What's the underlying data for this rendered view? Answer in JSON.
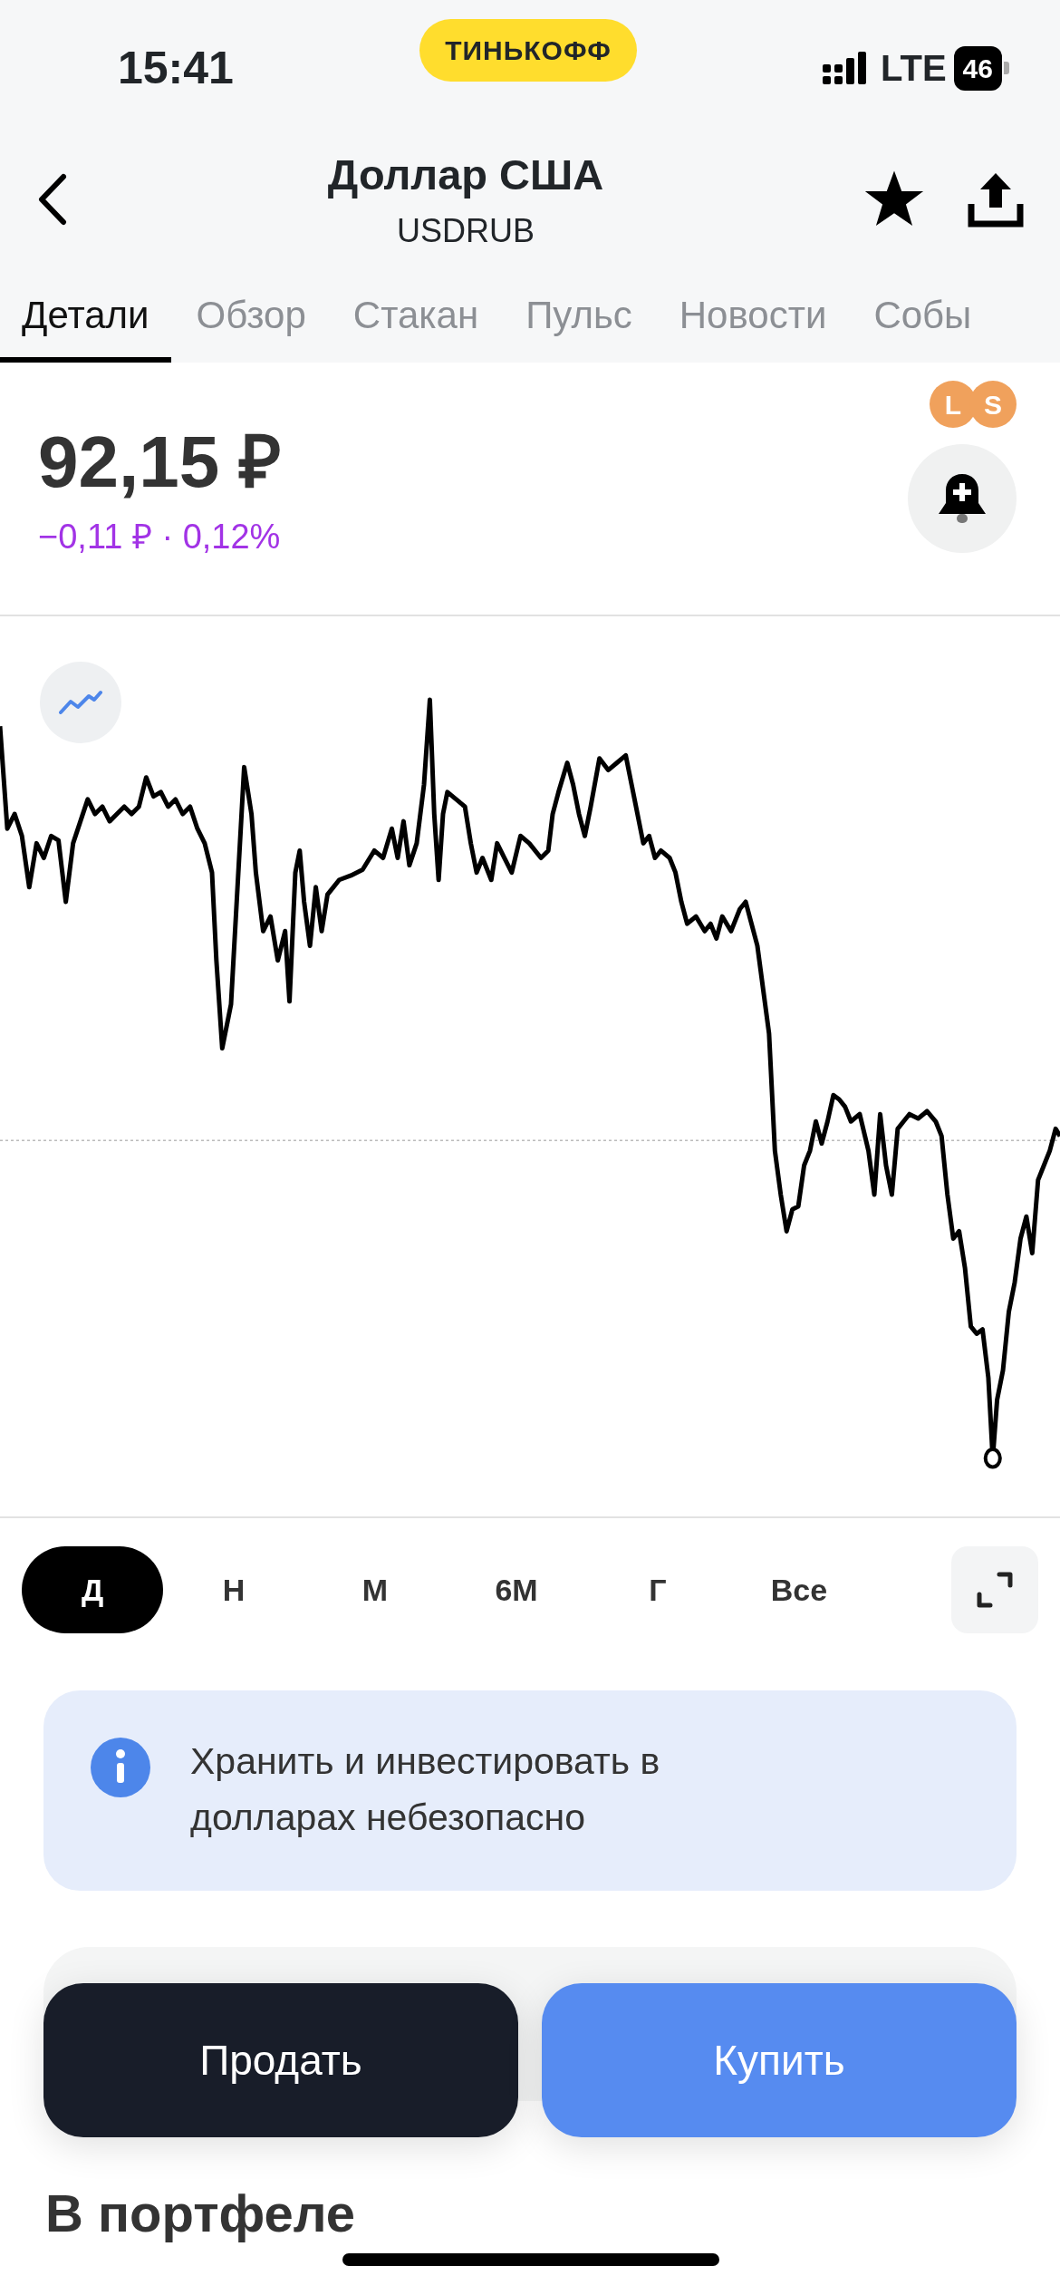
{
  "status_bar": {
    "time": "15:41",
    "carrier_badge": "ТИНЬКОФФ",
    "network": "LTE",
    "battery": "46"
  },
  "header": {
    "title": "Доллар США",
    "subtitle": "USDRUB"
  },
  "tabs": [
    {
      "label": "Детали",
      "selected": true
    },
    {
      "label": "Обзор",
      "selected": false
    },
    {
      "label": "Стакан",
      "selected": false
    },
    {
      "label": "Пульс",
      "selected": false
    },
    {
      "label": "Новости",
      "selected": false
    },
    {
      "label": "Собы",
      "selected": false
    }
  ],
  "quote": {
    "price": "92,15 ₽",
    "change": "−0,11 ₽ · 0,12%",
    "badges": [
      "L",
      "S"
    ]
  },
  "periods": [
    {
      "label": "Д",
      "selected": true
    },
    {
      "label": "Н",
      "selected": false
    },
    {
      "label": "М",
      "selected": false
    },
    {
      "label": "6М",
      "selected": false
    },
    {
      "label": "Г",
      "selected": false
    },
    {
      "label": "Все",
      "selected": false
    }
  ],
  "notice": {
    "text": "Хранить и инвестировать в долларах небезопасно"
  },
  "actions": [
    {
      "label": "Продать",
      "kind": "sell"
    },
    {
      "label": "Купить",
      "kind": "buy"
    }
  ],
  "section_title": "В портфеле"
}
